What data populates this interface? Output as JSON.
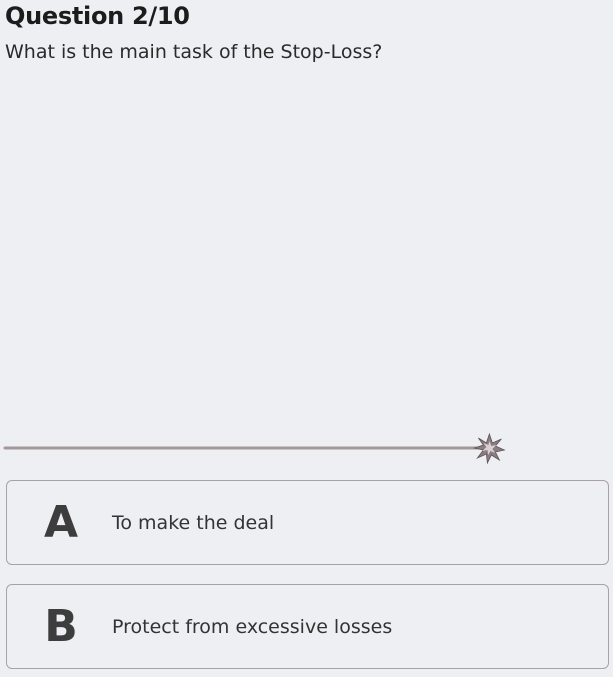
{
  "question": {
    "header": "Question 2/10",
    "text": "What is the main task of the Stop-Loss?"
  },
  "timer": {
    "remaining_fraction": 0.81,
    "line_color": "#a4979a",
    "spark_icon": "spark-fuse-icon"
  },
  "answers": [
    {
      "letter": "A",
      "text": "To make the deal"
    },
    {
      "letter": "B",
      "text": "Protect from excessive losses"
    }
  ],
  "colors": {
    "background": "#eeeff2",
    "border": "#a9a2a4"
  }
}
